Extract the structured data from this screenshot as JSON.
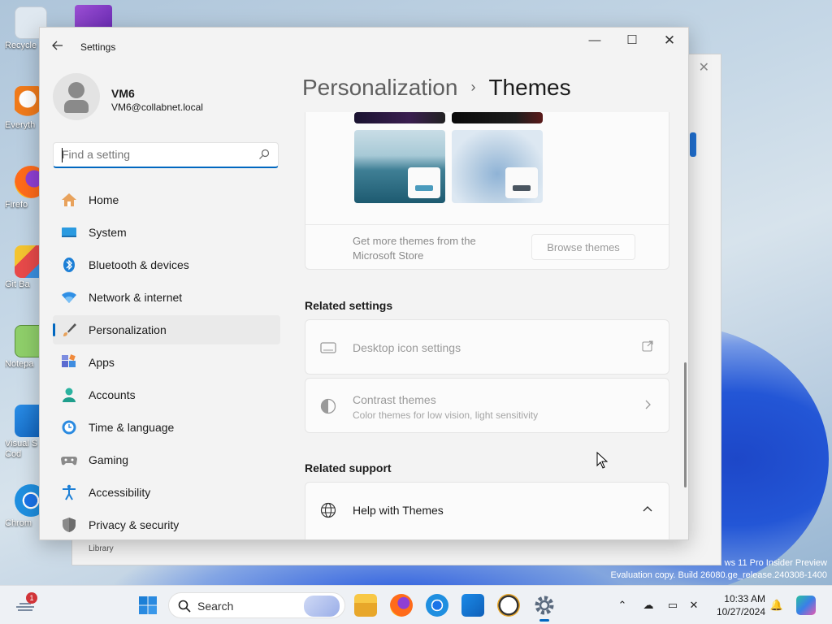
{
  "window": {
    "app_title": "Settings"
  },
  "profile": {
    "name": "VM6",
    "email": "VM6@collabnet.local"
  },
  "search": {
    "placeholder": "Find a setting"
  },
  "nav": {
    "items": [
      {
        "label": "Home",
        "icon": "home-icon"
      },
      {
        "label": "System",
        "icon": "system-icon"
      },
      {
        "label": "Bluetooth & devices",
        "icon": "bluetooth-icon"
      },
      {
        "label": "Network & internet",
        "icon": "network-icon"
      },
      {
        "label": "Personalization",
        "icon": "personalization-brush-icon",
        "active": true
      },
      {
        "label": "Apps",
        "icon": "apps-icon"
      },
      {
        "label": "Accounts",
        "icon": "accounts-icon"
      },
      {
        "label": "Time & language",
        "icon": "time-language-icon"
      },
      {
        "label": "Gaming",
        "icon": "gaming-icon"
      },
      {
        "label": "Accessibility",
        "icon": "accessibility-icon"
      },
      {
        "label": "Privacy & security",
        "icon": "privacy-shield-icon"
      }
    ]
  },
  "breadcrumb": {
    "parent": "Personalization",
    "separator": "›",
    "current": "Themes"
  },
  "themes_card": {
    "more_text": "Get more themes from the Microsoft Store",
    "browse_label": "Browse themes"
  },
  "related_settings": {
    "heading": "Related settings",
    "items": [
      {
        "title": "Desktop icon settings",
        "subtitle": "",
        "icon": "monitor-icon",
        "trail": "external-link-icon"
      },
      {
        "title": "Contrast themes",
        "subtitle": "Color themes for low vision, light sensitivity",
        "icon": "contrast-icon",
        "trail": "chevron-right-icon"
      }
    ]
  },
  "related_support": {
    "heading": "Related support",
    "help_title": "Help with Themes",
    "help_icon": "globe-icon",
    "help_trail": "chevron-up-icon"
  },
  "desktop": {
    "icons": [
      "Recycle",
      "Everyth",
      "Firefo",
      "Git Ba",
      "Notepa",
      "Visual S Cod",
      "Chrom"
    ],
    "background_window": {
      "footer": "Library"
    },
    "watermark": [
      "ws 11 Pro Insider Preview",
      "Evaluation copy. Build 26080.ge_release.240308-1400"
    ]
  },
  "taskbar": {
    "search_label": "Search",
    "notification_count": "1",
    "time": "10:33 AM",
    "date": "10/27/2024"
  },
  "colors": {
    "accent": "#0067c0",
    "window_bg": "#f3f3f3",
    "card_bg": "#fbfbfb"
  }
}
